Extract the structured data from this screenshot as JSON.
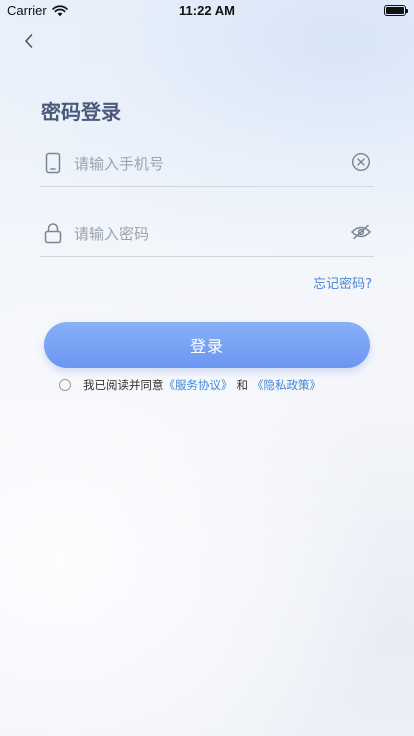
{
  "status_bar": {
    "carrier": "Carrier",
    "time": "11:22 AM",
    "battery_level": 1.0
  },
  "icons": {
    "back": "chevron-left-icon",
    "phone": "phone-icon",
    "clear": "clear-circle-icon",
    "lock": "lock-icon",
    "visibility": "eye-off-icon"
  },
  "header": {
    "title": "密码登录"
  },
  "form": {
    "phone_placeholder": "请输入手机号",
    "password_placeholder": "请输入密码",
    "forgot_label": "忘记密码?",
    "login_label": "登录"
  },
  "agreement": {
    "prefix": "我已阅读并同意",
    "service_link": "《服务协议》",
    "conjunction": "和",
    "privacy_link": "《隐私政策》"
  },
  "colors": {
    "accent": "#6b96f2",
    "link": "#3e86d6",
    "title": "#4a5a78"
  }
}
